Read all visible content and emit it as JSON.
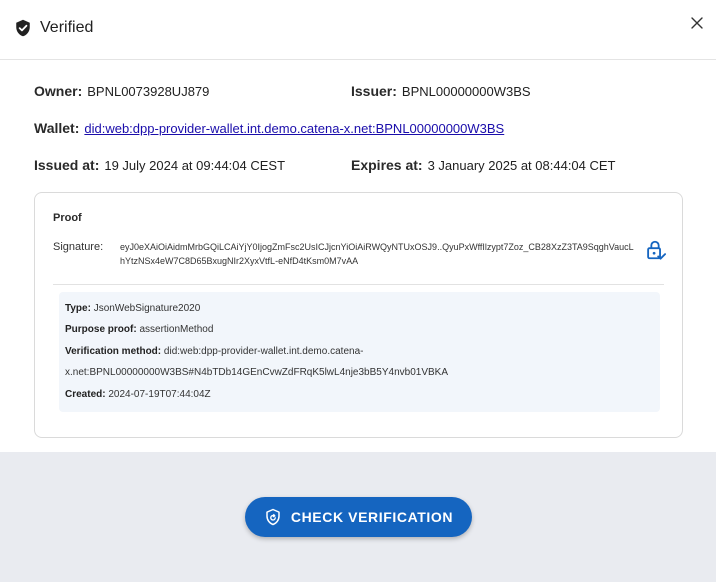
{
  "dialog": {
    "title": "Verified",
    "icons": {
      "status": "shield-check-icon",
      "close": "close-icon"
    }
  },
  "fields": {
    "owner": {
      "label": "Owner:",
      "value": "BPNL0073928UJ879"
    },
    "issuer": {
      "label": "Issuer:",
      "value": "BPNL00000000W3BS"
    },
    "wallet": {
      "label": "Wallet:",
      "value": "did:web:dpp-provider-wallet.int.demo.catena-x.net:BPNL00000000W3BS"
    },
    "issued_at": {
      "label": "Issued at:",
      "value": "19 July 2024 at 09:44:04 CEST"
    },
    "expires_at": {
      "label": "Expires at:",
      "value": "3 January 2025 at 08:44:04 CET"
    }
  },
  "proof": {
    "title": "Proof",
    "signature_label": "Signature:",
    "signature_value": "eyJ0eXAiOiAidmMrbGQiLCAiYjY0IjogZmFsc2UsICJjcnYiOiAiRWQyNTUxOSJ9..QyuPxWffIlzypt7Zoz_CB28XzZ3TA9SqghVaucLhYtzNSx4eW7C8D65BxugNIr2XyxVtfL-eNfD4tKsm0M7vAA",
    "lock_icon": "lock-check-icon",
    "details": {
      "type": {
        "label": "Type:",
        "value": "JsonWebSignature2020"
      },
      "purpose": {
        "label": "Purpose proof:",
        "value": "assertionMethod"
      },
      "method": {
        "label": "Verification method:",
        "value_line1": "did:web:dpp-provider-wallet.int.demo.catena-",
        "value_line2": "x.net:BPNL00000000W3BS#N4bTDb14GEnCvwZdFRqK5lwL4nje3bB5Y4nvb01VBKA"
      },
      "created": {
        "label": "Created:",
        "value": "2024-07-19T07:44:04Z"
      }
    }
  },
  "actions": {
    "check_label": "CHECK VERIFICATION",
    "check_icon": "shield-refresh-icon"
  },
  "colors": {
    "primary": "#1565c0",
    "footer_bg": "#e9ebf0",
    "details_bg": "#f2f6fb",
    "link": "#1a0dab"
  }
}
